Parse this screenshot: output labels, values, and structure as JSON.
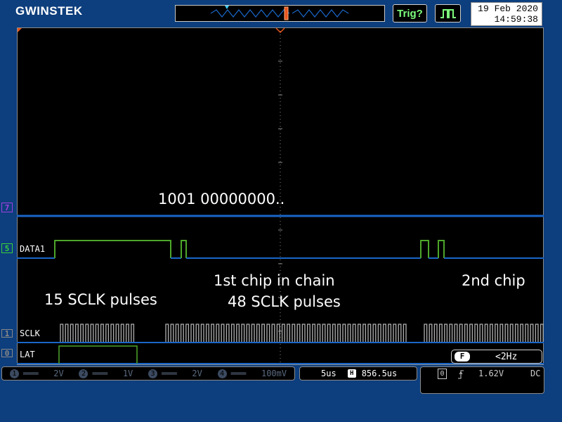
{
  "brand": {
    "logo": "GWINSTEK"
  },
  "header": {
    "trig_label": "Trig?",
    "date": "19 Feb 2020",
    "time": "14:59:38"
  },
  "channels": {
    "ch7_indicator": "7",
    "data1_indicator": "5",
    "data1_label": "DATA1",
    "sclk_label": "SCLK",
    "lat_label": "LAT",
    "sclk_indicator": "1",
    "lat_indicator": "0"
  },
  "annotations": {
    "bits": "1001 00000000..",
    "pulses_15": "15 SCLK pulses",
    "first_chip": "1st chip in chain",
    "pulses_48": "48 SCLK pulses",
    "second_chip": "2nd chip"
  },
  "bottom_bar": {
    "ch1_num": "1",
    "ch1_coupling": "═══",
    "ch1_scale": "2V",
    "ch2_num": "2",
    "ch2_coupling": "═══",
    "ch2_scale": "1V",
    "ch3_num": "3",
    "ch3_coupling": "═══",
    "ch3_scale": "2V",
    "ch4_num": "4",
    "ch4_coupling": "═══",
    "ch4_scale": "100mV",
    "timebase": "5us",
    "h_position_icon_label": "H",
    "h_position": "856.5us",
    "trigger_source": "0",
    "trigger_level": "1.62V",
    "trigger_coupling": "DC",
    "freq_icon_label": "F",
    "frequency": "<2Hz"
  },
  "colors": {
    "background": "#0d3e7d",
    "screen": "#000000",
    "grid": "#6e6e6e",
    "trace_blue": "#1a66c8",
    "trace_green": "#4da62a",
    "trace_gray": "#b0b0b0",
    "trig_green": "#7dff7d",
    "orange_marker": "#e8541c"
  }
}
